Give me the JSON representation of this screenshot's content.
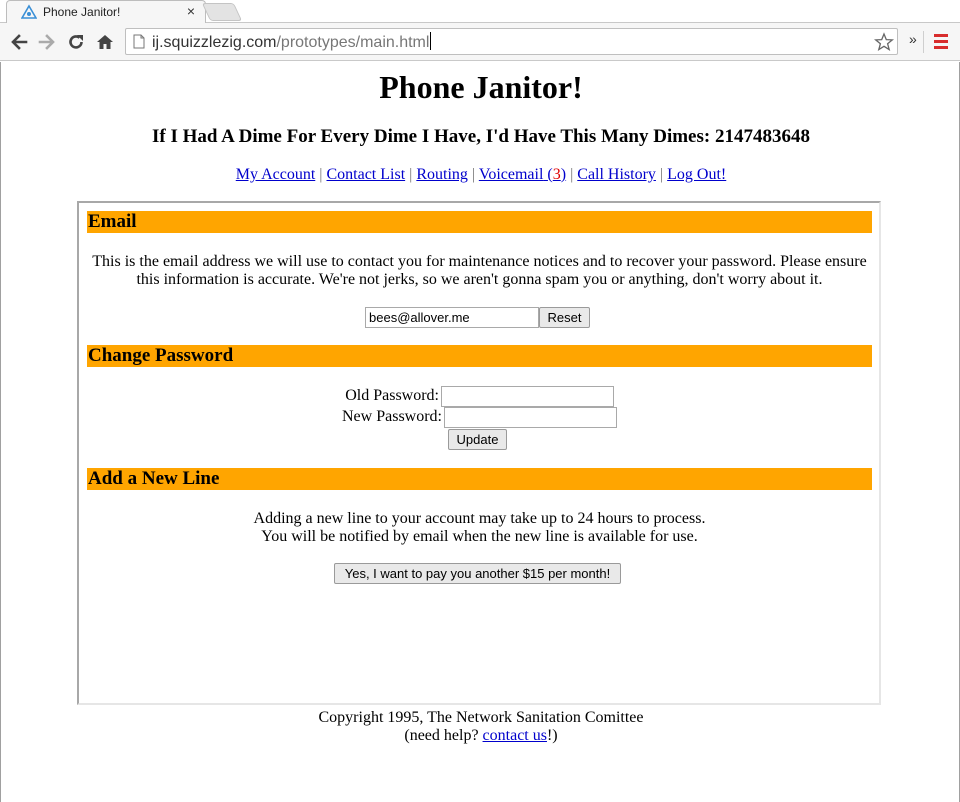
{
  "browser": {
    "tab_title": "Phone Janitor!",
    "tab_close": "×",
    "url_host": "ij.squizzlezig.com",
    "url_path": "/prototypes/main.html",
    "overflow_glyph": "»"
  },
  "site": {
    "title": "Phone Janitor!",
    "subtitle": "If I Had A Dime For Every Dime I Have, I'd Have This Many Dimes: 2147483648"
  },
  "nav": {
    "my_account": "My Account",
    "contact_list": "Contact List",
    "routing": "Routing",
    "voicemail": "Voicemail",
    "voicemail_open": "(",
    "voicemail_count": "3",
    "voicemail_close": ")",
    "call_history": "Call History",
    "log_out": "Log Out!",
    "separator": "|"
  },
  "email_section": {
    "heading": "Email",
    "description": "This is the email address we will use to contact you for maintenance notices and to recover your password. Please ensure this information is accurate. We're not jerks, so we aren't gonna spam you or anything, don't worry about it.",
    "email_value": "bees@allover.me",
    "reset_label": "Reset"
  },
  "password_section": {
    "heading": "Change Password",
    "old_label": "Old Password:",
    "new_label": "New Password:",
    "old_value": "",
    "new_value": "",
    "update_label": "Update"
  },
  "line_section": {
    "heading": "Add a New Line",
    "line1": "Adding a new line to your account may take up to 24 hours to process.",
    "line2": "You will be notified by email when the new line is available for use.",
    "confirm_label": "Yes, I want to pay you another $15 per month!"
  },
  "footer": {
    "copyright": "Copyright 1995, The Network Sanitation Comittee",
    "help_prefix": "(need help? ",
    "help_link": "contact us",
    "help_suffix": "!)"
  },
  "colors": {
    "section_header": "#ffa500",
    "link": "#0000cc",
    "badge": "#e00000",
    "menu_icon": "#d82d2d"
  }
}
